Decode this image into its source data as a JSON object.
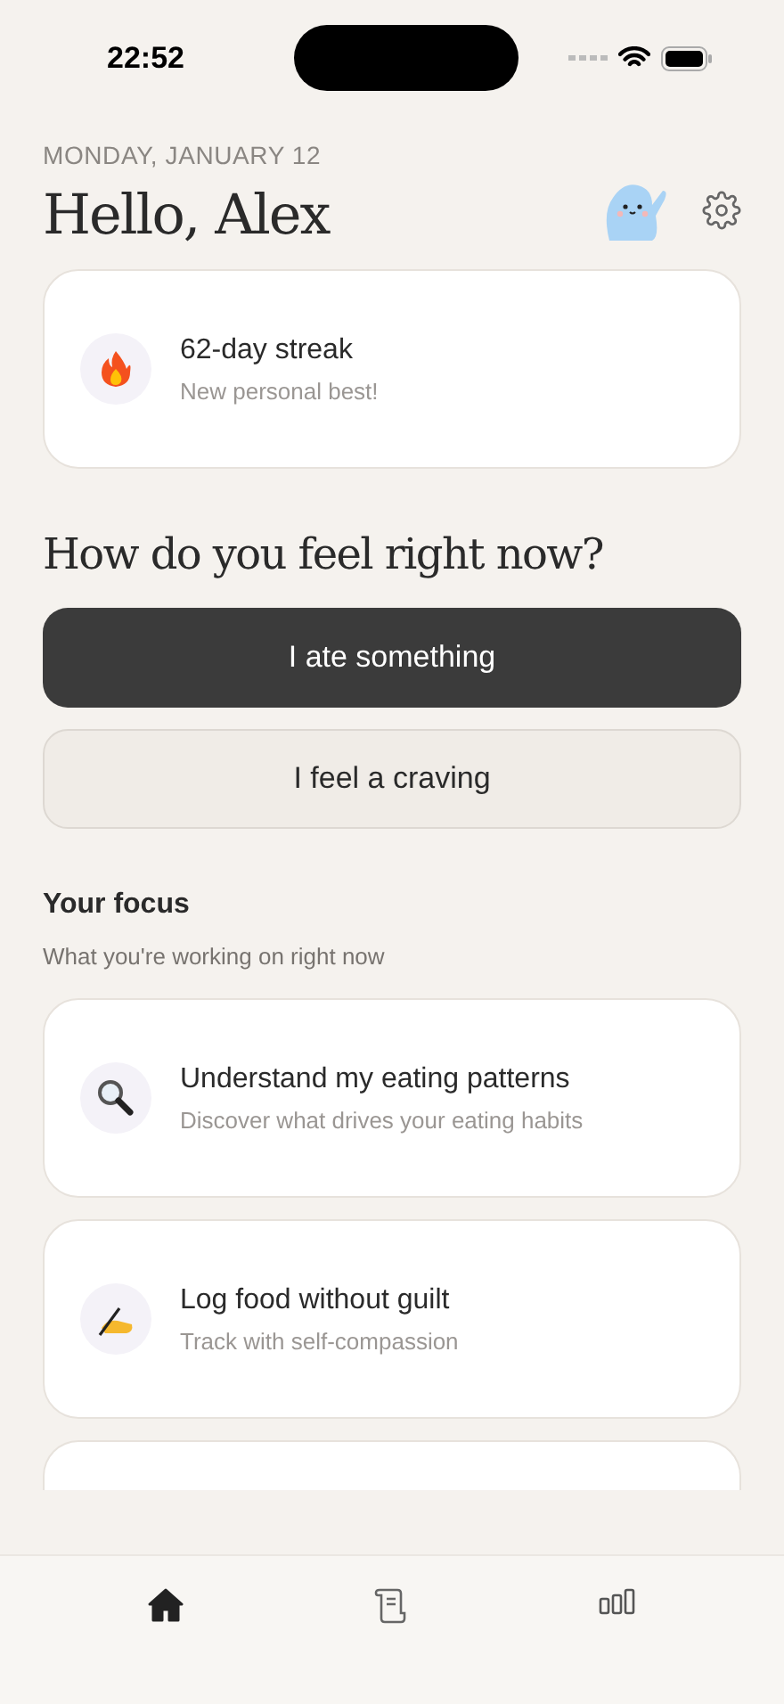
{
  "status_bar": {
    "time": "22:52"
  },
  "header": {
    "date": "MONDAY, JANUARY 12",
    "greeting": "Hello, Alex"
  },
  "streak": {
    "title": "62-day streak",
    "subtitle": "New personal best!"
  },
  "question": "How do you feel right now?",
  "actions": [
    {
      "label": "I ate something",
      "kind": "primary"
    },
    {
      "label": "I feel a craving",
      "kind": "secondary"
    }
  ],
  "focus": {
    "title": "Your focus",
    "subtitle": "What you're working on right now",
    "items": [
      {
        "kind": "search",
        "title": "Understand my eating patterns",
        "subtitle": "Discover what drives your eating habits"
      },
      {
        "kind": "writing",
        "title": "Log food without guilt",
        "subtitle": "Track with self-compassion"
      },
      {
        "kind": "blank"
      }
    ]
  },
  "tabs": [
    {
      "kind": "home",
      "selected": true
    },
    {
      "kind": "journal",
      "selected": false
    },
    {
      "kind": "stats",
      "selected": false
    }
  ]
}
